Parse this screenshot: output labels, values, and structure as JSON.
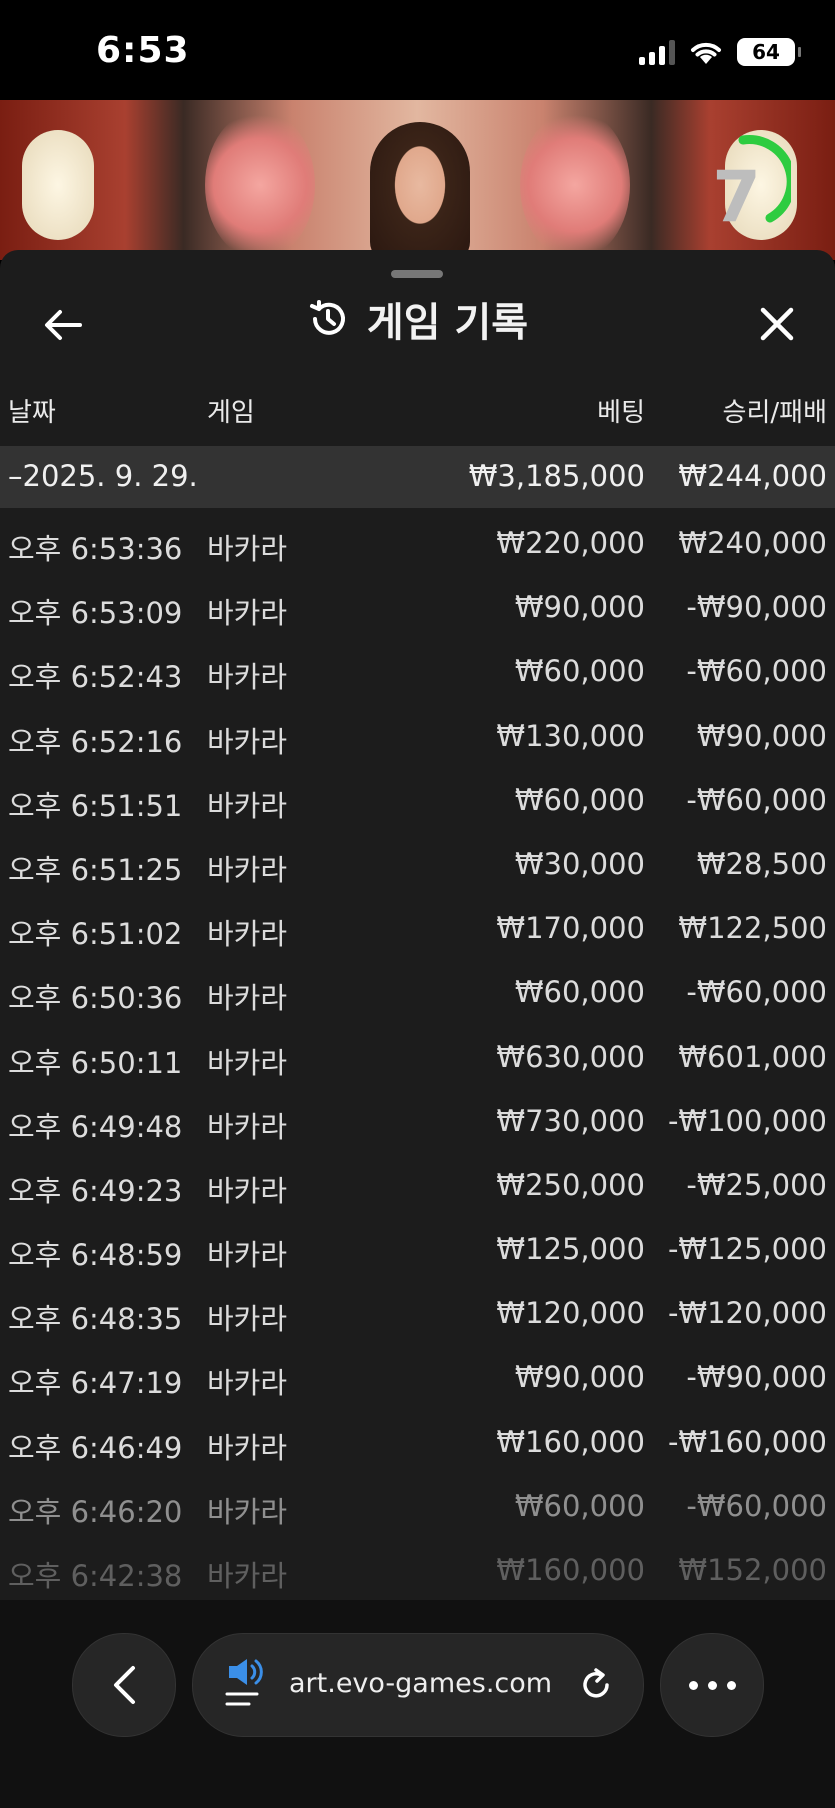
{
  "status_bar": {
    "time": "6:53",
    "battery": "64"
  },
  "video": {
    "countdown": "7"
  },
  "panel": {
    "title": "게임 기록",
    "columns": {
      "date": "날짜",
      "game": "게임",
      "bet": "베팅",
      "win_loss": "승리/패배"
    },
    "summary": {
      "date": "–2025. 9. 29.",
      "bet": "₩3,185,000",
      "win_loss": "₩244,000"
    },
    "rows": [
      {
        "time": "오후 6:53:36",
        "game": "바카라",
        "bet": "₩220,000",
        "result": "₩240,000"
      },
      {
        "time": "오후 6:53:09",
        "game": "바카라",
        "bet": "₩90,000",
        "result": "-₩90,000"
      },
      {
        "time": "오후 6:52:43",
        "game": "바카라",
        "bet": "₩60,000",
        "result": "-₩60,000"
      },
      {
        "time": "오후 6:52:16",
        "game": "바카라",
        "bet": "₩130,000",
        "result": "₩90,000"
      },
      {
        "time": "오후 6:51:51",
        "game": "바카라",
        "bet": "₩60,000",
        "result": "-₩60,000"
      },
      {
        "time": "오후 6:51:25",
        "game": "바카라",
        "bet": "₩30,000",
        "result": "₩28,500"
      },
      {
        "time": "오후 6:51:02",
        "game": "바카라",
        "bet": "₩170,000",
        "result": "₩122,500"
      },
      {
        "time": "오후 6:50:36",
        "game": "바카라",
        "bet": "₩60,000",
        "result": "-₩60,000"
      },
      {
        "time": "오후 6:50:11",
        "game": "바카라",
        "bet": "₩630,000",
        "result": "₩601,000"
      },
      {
        "time": "오후 6:49:48",
        "game": "바카라",
        "bet": "₩730,000",
        "result": "-₩100,000"
      },
      {
        "time": "오후 6:49:23",
        "game": "바카라",
        "bet": "₩250,000",
        "result": "-₩25,000"
      },
      {
        "time": "오후 6:48:59",
        "game": "바카라",
        "bet": "₩125,000",
        "result": "-₩125,000"
      },
      {
        "time": "오후 6:48:35",
        "game": "바카라",
        "bet": "₩120,000",
        "result": "-₩120,000"
      },
      {
        "time": "오후 6:47:19",
        "game": "바카라",
        "bet": "₩90,000",
        "result": "-₩90,000"
      },
      {
        "time": "오후 6:46:49",
        "game": "바카라",
        "bet": "₩160,000",
        "result": "-₩160,000"
      },
      {
        "time": "오후 6:46:20",
        "game": "바카라",
        "bet": "₩60,000",
        "result": "-₩60,000"
      },
      {
        "time": "오후 6:42:38",
        "game": "바카라",
        "bet": "₩160,000",
        "result": "₩152,000"
      }
    ]
  },
  "browser": {
    "url": "art.evo-games.com"
  },
  "colors": {
    "panel_bg": "#1c1c1c",
    "summary_bg": "#333333",
    "timer_green": "#2ecc40"
  }
}
